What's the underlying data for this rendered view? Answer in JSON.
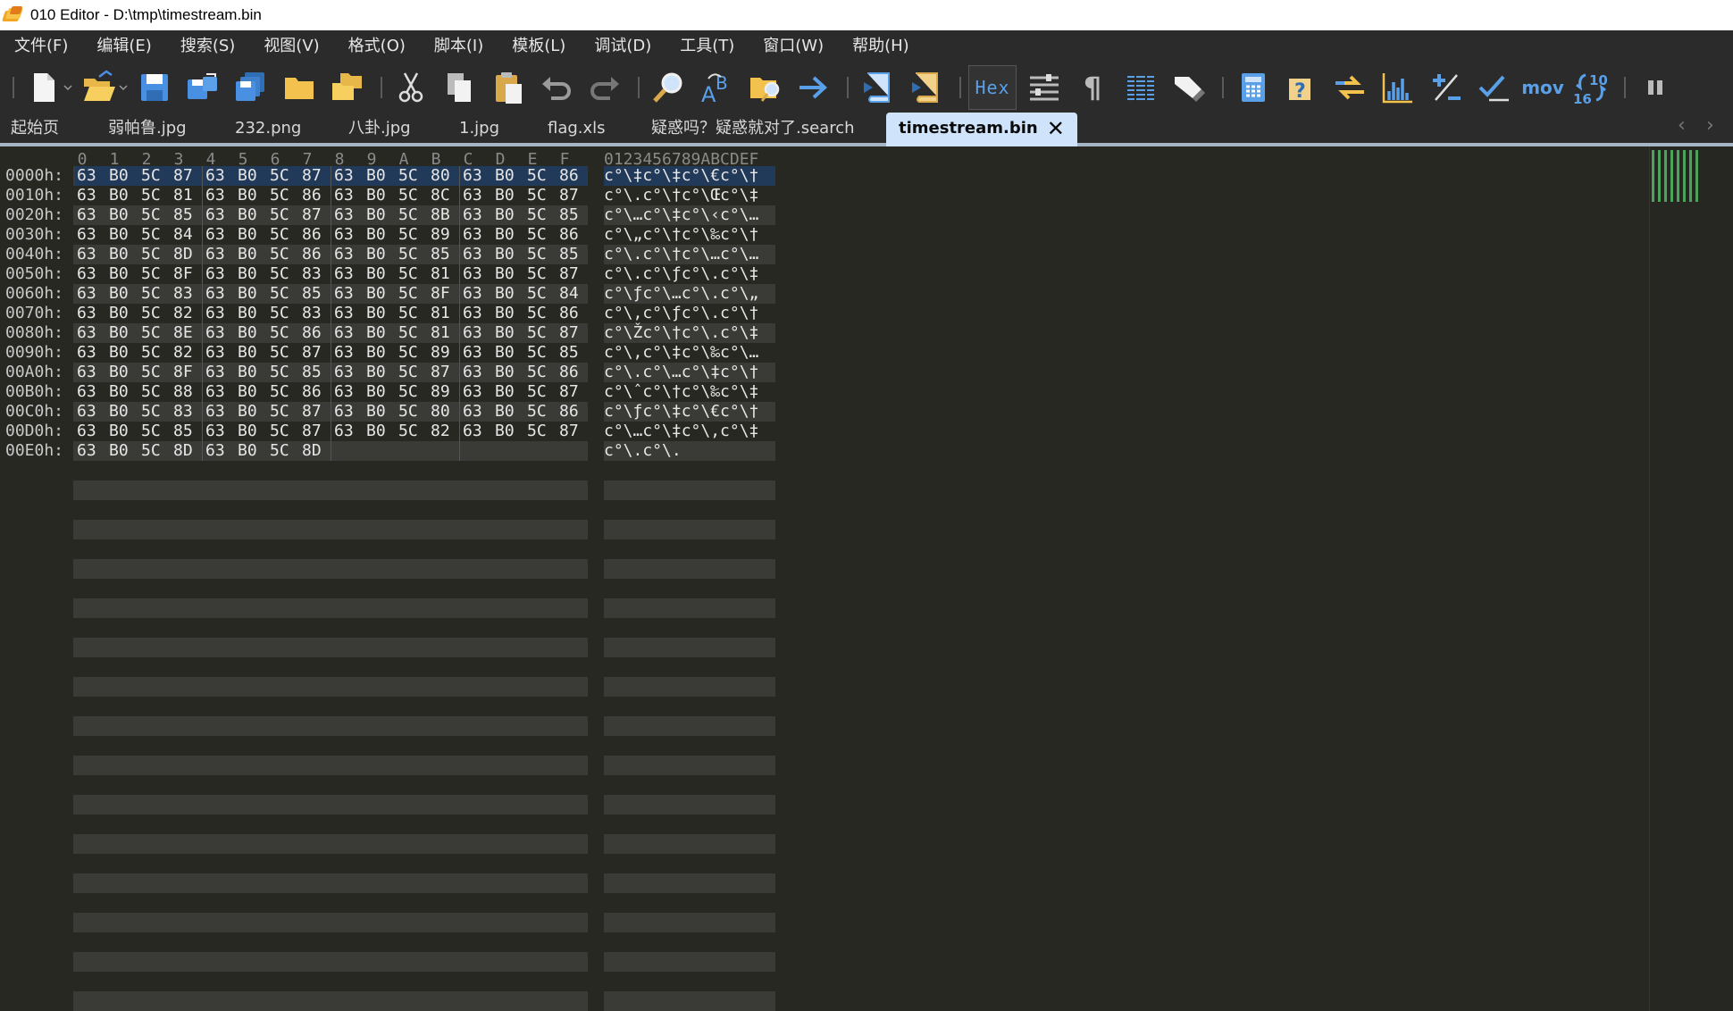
{
  "window": {
    "title": "010 Editor - D:\\tmp\\timestream.bin"
  },
  "menu": [
    "文件(F)",
    "编辑(E)",
    "搜索(S)",
    "视图(V)",
    "格式(O)",
    "脚本(I)",
    "模板(L)",
    "调试(D)",
    "工具(T)",
    "窗口(W)",
    "帮助(H)"
  ],
  "toolbar": {
    "hex_label": "Hex",
    "mov_label": "mov",
    "base_top": "10",
    "base_bottom": "16",
    "pilcrow": "¶"
  },
  "tabs": [
    "起始页",
    "弱帕鲁.jpg",
    "232.png",
    "八卦.jpg",
    "1.jpg",
    "flag.xls",
    "疑惑吗？疑惑就对了.search"
  ],
  "active_tab": {
    "label": "timestream.bin",
    "close": "✕"
  },
  "tab_nav": {
    "left": "‹",
    "right": "›"
  },
  "hex_view": {
    "column_headers": [
      "0",
      "1",
      "2",
      "3",
      "4",
      "5",
      "6",
      "7",
      "8",
      "9",
      "A",
      "B",
      "C",
      "D",
      "E",
      "F"
    ],
    "ascii_header": "0123456789ABCDEF",
    "rows": [
      {
        "addr": "0000h:",
        "bytes": [
          "63",
          "B0",
          "5C",
          "87",
          "63",
          "B0",
          "5C",
          "87",
          "63",
          "B0",
          "5C",
          "80",
          "63",
          "B0",
          "5C",
          "86"
        ],
        "ascii": "c°\\‡c°\\‡c°\\€c°\\†"
      },
      {
        "addr": "0010h:",
        "bytes": [
          "63",
          "B0",
          "5C",
          "81",
          "63",
          "B0",
          "5C",
          "86",
          "63",
          "B0",
          "5C",
          "8C",
          "63",
          "B0",
          "5C",
          "87"
        ],
        "ascii": "c°\\.c°\\†c°\\Œc°\\‡"
      },
      {
        "addr": "0020h:",
        "bytes": [
          "63",
          "B0",
          "5C",
          "85",
          "63",
          "B0",
          "5C",
          "87",
          "63",
          "B0",
          "5C",
          "8B",
          "63",
          "B0",
          "5C",
          "85"
        ],
        "ascii": "c°\\…c°\\‡c°\\‹c°\\…"
      },
      {
        "addr": "0030h:",
        "bytes": [
          "63",
          "B0",
          "5C",
          "84",
          "63",
          "B0",
          "5C",
          "86",
          "63",
          "B0",
          "5C",
          "89",
          "63",
          "B0",
          "5C",
          "86"
        ],
        "ascii": "c°\\„c°\\†c°\\‰c°\\†"
      },
      {
        "addr": "0040h:",
        "bytes": [
          "63",
          "B0",
          "5C",
          "8D",
          "63",
          "B0",
          "5C",
          "86",
          "63",
          "B0",
          "5C",
          "85",
          "63",
          "B0",
          "5C",
          "85"
        ],
        "ascii": "c°\\.c°\\†c°\\…c°\\…"
      },
      {
        "addr": "0050h:",
        "bytes": [
          "63",
          "B0",
          "5C",
          "8F",
          "63",
          "B0",
          "5C",
          "83",
          "63",
          "B0",
          "5C",
          "81",
          "63",
          "B0",
          "5C",
          "87"
        ],
        "ascii": "c°\\.c°\\ƒc°\\.c°\\‡"
      },
      {
        "addr": "0060h:",
        "bytes": [
          "63",
          "B0",
          "5C",
          "83",
          "63",
          "B0",
          "5C",
          "85",
          "63",
          "B0",
          "5C",
          "8F",
          "63",
          "B0",
          "5C",
          "84"
        ],
        "ascii": "c°\\ƒc°\\…c°\\.c°\\„"
      },
      {
        "addr": "0070h:",
        "bytes": [
          "63",
          "B0",
          "5C",
          "82",
          "63",
          "B0",
          "5C",
          "83",
          "63",
          "B0",
          "5C",
          "81",
          "63",
          "B0",
          "5C",
          "86"
        ],
        "ascii": "c°\\‚c°\\ƒc°\\.c°\\†"
      },
      {
        "addr": "0080h:",
        "bytes": [
          "63",
          "B0",
          "5C",
          "8E",
          "63",
          "B0",
          "5C",
          "86",
          "63",
          "B0",
          "5C",
          "81",
          "63",
          "B0",
          "5C",
          "87"
        ],
        "ascii": "c°\\Žc°\\†c°\\.c°\\‡"
      },
      {
        "addr": "0090h:",
        "bytes": [
          "63",
          "B0",
          "5C",
          "82",
          "63",
          "B0",
          "5C",
          "87",
          "63",
          "B0",
          "5C",
          "89",
          "63",
          "B0",
          "5C",
          "85"
        ],
        "ascii": "c°\\‚c°\\‡c°\\‰c°\\…"
      },
      {
        "addr": "00A0h:",
        "bytes": [
          "63",
          "B0",
          "5C",
          "8F",
          "63",
          "B0",
          "5C",
          "85",
          "63",
          "B0",
          "5C",
          "87",
          "63",
          "B0",
          "5C",
          "86"
        ],
        "ascii": "c°\\.c°\\…c°\\‡c°\\†"
      },
      {
        "addr": "00B0h:",
        "bytes": [
          "63",
          "B0",
          "5C",
          "88",
          "63",
          "B0",
          "5C",
          "86",
          "63",
          "B0",
          "5C",
          "89",
          "63",
          "B0",
          "5C",
          "87"
        ],
        "ascii": "c°\\ˆc°\\†c°\\‰c°\\‡"
      },
      {
        "addr": "00C0h:",
        "bytes": [
          "63",
          "B0",
          "5C",
          "83",
          "63",
          "B0",
          "5C",
          "87",
          "63",
          "B0",
          "5C",
          "80",
          "63",
          "B0",
          "5C",
          "86"
        ],
        "ascii": "c°\\ƒc°\\‡c°\\€c°\\†"
      },
      {
        "addr": "00D0h:",
        "bytes": [
          "63",
          "B0",
          "5C",
          "85",
          "63",
          "B0",
          "5C",
          "87",
          "63",
          "B0",
          "5C",
          "82",
          "63",
          "B0",
          "5C",
          "87"
        ],
        "ascii": "c°\\…c°\\‡c°\\‚c°\\‡"
      },
      {
        "addr": "00E0h:",
        "bytes": [
          "63",
          "B0",
          "5C",
          "8D",
          "63",
          "B0",
          "5C",
          "8D"
        ],
        "ascii": "c°\\.c°\\."
      }
    ]
  },
  "colors": {
    "background": "#272822",
    "chrome": "#2b2b2b",
    "active_tab": "#cfe4fb",
    "accent_blue": "#5aa0e8",
    "minimap_green": "#4ea35a"
  }
}
